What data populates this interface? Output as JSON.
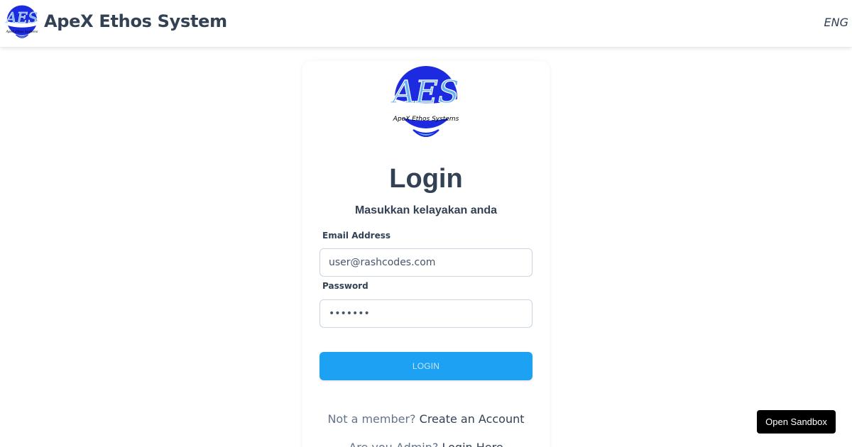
{
  "header": {
    "title": "ApeX Ethos System",
    "language": "ENG",
    "logo_icon": "aes-logo-icon",
    "logo_text": "AES",
    "logo_subtext": "ApeX Ethos Systems"
  },
  "login": {
    "title": "Login",
    "subtitle": "Masukkan kelayakan anda",
    "email_label": "Email Address",
    "email_value": "user@rashcodes.com",
    "password_label": "Password",
    "password_value": "•••••••",
    "button_label": "LOGIN",
    "member_prompt": "Not a member?",
    "create_account_label": "Create an Account",
    "admin_prompt": "Are you Admin?",
    "admin_login_label": "Login Here"
  },
  "sandbox_label": "Open Sandbox",
  "colors": {
    "primary_text": "#334155",
    "button_bg": "#1da1f2",
    "logo_blue": "#1d2be0",
    "logo_light": "#66b3f0"
  }
}
